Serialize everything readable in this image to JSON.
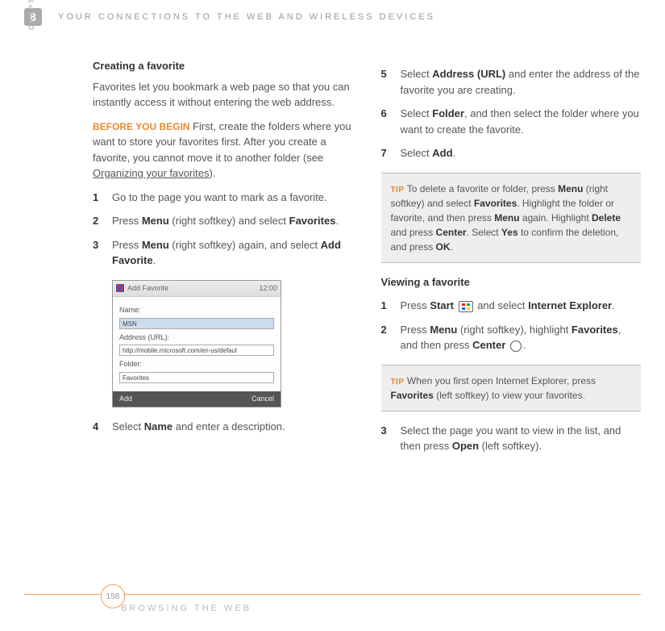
{
  "header": {
    "chapter_number": "8",
    "title": "YOUR CONNECTIONS TO THE WEB AND WIRELESS DEVICES",
    "side_label": "CHAPTER"
  },
  "left": {
    "title": "Creating a favorite",
    "intro": "Favorites let you bookmark a web page so that you can instantly access it without entering the web address.",
    "before_label": "BEFORE YOU BEGIN",
    "before_text1": "  First, create the folders where you want to store your favorites first. After you create a favorite, you cannot move it to another folder (see ",
    "before_link": "Organizing your favorites",
    "before_text2": ").",
    "steps": [
      {
        "n": "1",
        "t": "Go to the page you want to mark as a favorite."
      },
      {
        "n": "2",
        "p1": "Press ",
        "b1": "Menu",
        "p2": " (right softkey) and select ",
        "b2": "Favorites",
        "p3": "."
      },
      {
        "n": "3",
        "p1": "Press ",
        "b1": "Menu",
        "p2": " (right softkey) again, and select ",
        "b2": "Add Favorite",
        "p3": "."
      },
      {
        "n": "4",
        "p1": "Select ",
        "b1": "Name",
        "p2": " and enter a description."
      }
    ],
    "screenshot": {
      "title": "Add Favorite",
      "clock": "12:00",
      "name_label": "Name:",
      "name_value": "MSN",
      "url_label": "Address (URL):",
      "url_value": "http://mobile.microsoft.com/en-us/defaul",
      "folder_label": "Folder:",
      "folder_value": "Favorites",
      "left_soft": "Add",
      "right_soft": "Cancel"
    }
  },
  "right": {
    "steps_cont": [
      {
        "n": "5",
        "p1": "Select ",
        "b1": "Address (URL)",
        "p2": " and enter the address of the favorite you are creating."
      },
      {
        "n": "6",
        "p1": "Select ",
        "b1": "Folder",
        "p2": ", and then select the folder where you want to create the favorite."
      },
      {
        "n": "7",
        "p1": "Select ",
        "b1": "Add",
        "p2": "."
      }
    ],
    "tip1_label": "TIP",
    "tip1_p1": "To delete a favorite or folder, press ",
    "tip1_b1": "Menu",
    "tip1_p2": " (right softkey) and select ",
    "tip1_b2": "Favorites",
    "tip1_p3": ". Highlight the folder or favorite, and then press ",
    "tip1_b3": "Menu",
    "tip1_p4": " again. Highlight ",
    "tip1_b4": "Delete",
    "tip1_p5": " and press ",
    "tip1_b5": "Center",
    "tip1_p6": ". Select ",
    "tip1_b6": "Yes",
    "tip1_p7": " to confirm the deletion, and press ",
    "tip1_b7": "OK",
    "tip1_p8": ".",
    "view_title": "Viewing a favorite",
    "vsteps": [
      {
        "n": "1",
        "p1": "Press ",
        "b1": "Start",
        "p2": " and select ",
        "b2": "Internet Explorer",
        "p3": "."
      },
      {
        "n": "2",
        "p1": "Press ",
        "b1": "Menu",
        "p2": " (right softkey), highlight ",
        "b2": "Favorites",
        "p3": ", and then press ",
        "b3": "Center",
        "p4": "."
      }
    ],
    "tip2_label": "TIP",
    "tip2_p1": "When you first open Internet Explorer, press ",
    "tip2_b1": "Favorites",
    "tip2_p2": " (left softkey) to view your favorites.",
    "vstep3": {
      "n": "3",
      "p1": "Select the page you want to view in the list, and then press ",
      "b1": "Open",
      "p2": " (left softkey)."
    }
  },
  "footer": {
    "page": "158",
    "label": "BROWSING THE WEB"
  }
}
